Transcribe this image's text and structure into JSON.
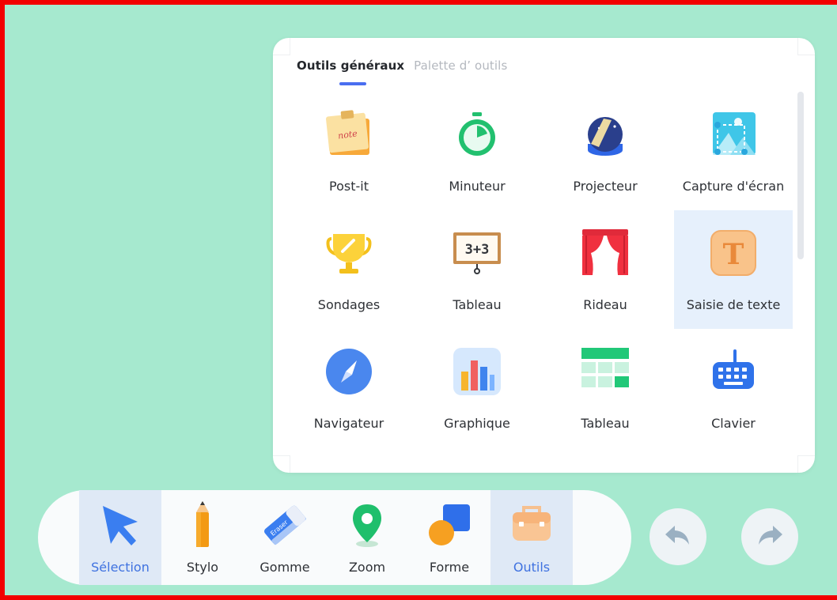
{
  "panel": {
    "tabs": [
      {
        "label": "Outils généraux",
        "active": true
      },
      {
        "label": "Palette d’ outils",
        "active": false
      }
    ],
    "tools": [
      {
        "label": "Post-it",
        "icon": "post-it-icon"
      },
      {
        "label": "Minuteur",
        "icon": "timer-icon"
      },
      {
        "label": "Projecteur",
        "icon": "spotlight-icon"
      },
      {
        "label": "Capture d'écran",
        "icon": "screenshot-icon"
      },
      {
        "label": "Sondages",
        "icon": "trophy-icon"
      },
      {
        "label": "Tableau",
        "icon": "blackboard-icon",
        "board_text": "3+3"
      },
      {
        "label": "Rideau",
        "icon": "curtain-icon"
      },
      {
        "label": "Saisie de texte",
        "icon": "text-input-icon",
        "glyph": "T",
        "highlighted": true
      },
      {
        "label": "Navigateur",
        "icon": "compass-icon"
      },
      {
        "label": "Graphique",
        "icon": "bar-chart-icon"
      },
      {
        "label": "Tableau",
        "icon": "table-icon"
      },
      {
        "label": "Clavier",
        "icon": "keyboard-icon"
      }
    ],
    "post_it_text": "note"
  },
  "toolbar": {
    "items": [
      {
        "label": "Sélection",
        "icon": "cursor-arrow-icon",
        "active": true
      },
      {
        "label": "Stylo",
        "icon": "pencil-icon",
        "active": false
      },
      {
        "label": "Gomme",
        "icon": "eraser-icon",
        "active": false,
        "icon_text": "Eraser"
      },
      {
        "label": "Zoom",
        "icon": "map-pin-icon",
        "active": false
      },
      {
        "label": "Forme",
        "icon": "shapes-icon",
        "active": false
      },
      {
        "label": "Outils",
        "icon": "toolbox-icon",
        "active": true
      }
    ],
    "undo_icon": "undo-icon",
    "redo_icon": "redo-icon"
  },
  "colors": {
    "background": "#a6e9cf",
    "accent": "#4a6ef0",
    "active_label": "#3f72e0",
    "frame": "#f20000"
  }
}
